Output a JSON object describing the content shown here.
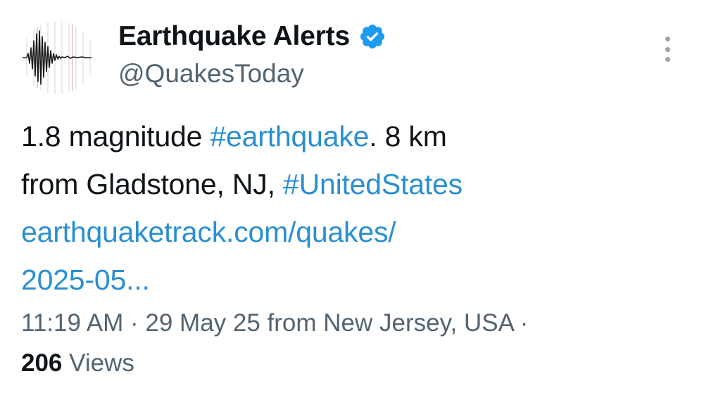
{
  "author": {
    "display_name": "Earthquake Alerts",
    "handle": "@QuakesToday",
    "verified": true,
    "avatar_icon": "seismograph-icon",
    "verified_color": "#1d9bf0"
  },
  "tweet": {
    "text_part1": "1.8 magnitude ",
    "hashtag1": "#earthquake",
    "text_part2": ". 8 km",
    "text_part3": "from Gladstone, NJ, ",
    "hashtag2": "#UnitedStates",
    "link_line1": "earthquaketrack.com/quakes/",
    "link_line2": "2025-05..."
  },
  "meta": {
    "time": "11:19 AM",
    "separator1": " · ",
    "date": "29 May 25",
    "location": " from New Jersey, USA",
    "separator2": " ·",
    "views_count": "206",
    "views_label": " Views"
  },
  "menu": {
    "more_icon": "more-vertical-icon"
  },
  "colors": {
    "link": "#2a8fd0",
    "text": "#0f1419",
    "muted": "#536471"
  }
}
